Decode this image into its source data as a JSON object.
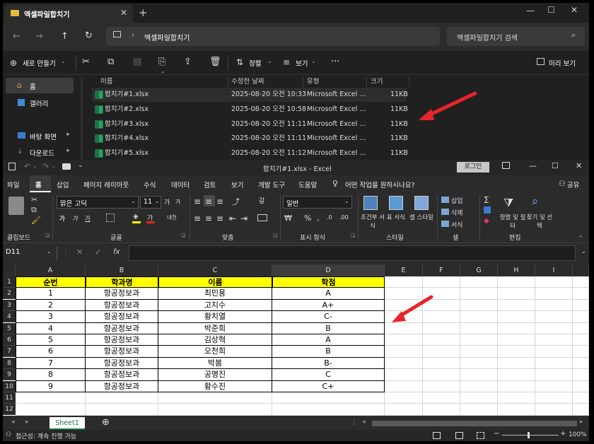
{
  "explorer": {
    "tab_title": "엑셀파일합치기",
    "address": "엑셀파일합치기",
    "search_placeholder": "엑셀파일합치기 검색",
    "toolbar": {
      "new_label": "새로 만들기",
      "sort_label": "정렬",
      "view_label": "보기",
      "preview_label": "미리 보기"
    },
    "sidebar": [
      {
        "label": "홈",
        "icon": "home-icon"
      },
      {
        "label": "갤러리",
        "icon": "gallery-icon"
      },
      {
        "label": "바탕 화면",
        "icon": "desktop-icon"
      },
      {
        "label": "다운로드",
        "icon": "download-icon"
      }
    ],
    "columns": [
      "이름",
      "수정한 날짜",
      "유형",
      "크기"
    ],
    "files": [
      {
        "name": "합치기#1.xlsx",
        "date": "2025-08-20 오전 10:33",
        "type": "Microsoft Excel ...",
        "size": "11KB"
      },
      {
        "name": "합치기#2.xlsx",
        "date": "2025-08-20 오전 10:58",
        "type": "Microsoft Excel ...",
        "size": "11KB"
      },
      {
        "name": "합치기#3.xlsx",
        "date": "2025-08-20 오전 11:11",
        "type": "Microsoft Excel ...",
        "size": "11KB"
      },
      {
        "name": "합치기#4.xlsx",
        "date": "2025-08-20 오전 11:11",
        "type": "Microsoft Excel ...",
        "size": "11KB"
      },
      {
        "name": "합치기#5.xlsx",
        "date": "2025-08-20 오전 11:12",
        "type": "Microsoft Excel ...",
        "size": "11KB"
      }
    ]
  },
  "excel": {
    "title": "합치기#1.xlsx  -  Excel",
    "login_label": "로그인",
    "menu": [
      "파일",
      "홈",
      "삽입",
      "페이지 레이아웃",
      "수식",
      "데이터",
      "검토",
      "보기",
      "개발 도구",
      "도움말"
    ],
    "tell_me": "어떤 작업을 원하시나요?",
    "share_label": "공유",
    "ribbon": {
      "font_name": "맑은 고딕",
      "font_size": "11",
      "number_format": "일반",
      "groups": [
        "클립보드",
        "글꼴",
        "맞춤",
        "표시 형식",
        "스타일",
        "셀",
        "편집"
      ],
      "cond_format": "조건부 서식",
      "table_format": "표 서식",
      "cell_style": "셀 스타일",
      "insert": "삽입",
      "delete": "삭제",
      "format": "서식",
      "sort_filter": "정렬 및 필터",
      "find_select": "찾기 및 선택"
    },
    "name_box": "D11",
    "fx": "fx",
    "columns": [
      "A",
      "B",
      "C",
      "D",
      "E",
      "F",
      "G",
      "H",
      "I"
    ],
    "rows": [
      "1",
      "2",
      "3",
      "4",
      "5",
      "6",
      "7",
      "8",
      "9",
      "10",
      "11",
      "12"
    ],
    "table_header": [
      "순번",
      "학과명",
      "이름",
      "학점"
    ],
    "table_rows": [
      [
        "1",
        "항공정보과",
        "최민용",
        "A"
      ],
      [
        "2",
        "항공정보과",
        "고지수",
        "A+"
      ],
      [
        "3",
        "항공정보과",
        "황치열",
        "C-"
      ],
      [
        "4",
        "항공정보과",
        "박준희",
        "B"
      ],
      [
        "5",
        "항공정보과",
        "김상혁",
        "A"
      ],
      [
        "6",
        "항공정보과",
        "오천희",
        "B"
      ],
      [
        "7",
        "항공정보과",
        "박봄",
        "B-"
      ],
      [
        "8",
        "항공정보과",
        "공명진",
        "C"
      ],
      [
        "9",
        "항공정보과",
        "황수진",
        "C+"
      ]
    ],
    "sheet_tab": "Sheet1",
    "status_text": "접근성: 계속 진행 가능",
    "zoom": "100%"
  },
  "colors": {
    "header_fill": "#ffff00",
    "arrow": "#e8242a",
    "sheet_tab": "#1e7145"
  }
}
